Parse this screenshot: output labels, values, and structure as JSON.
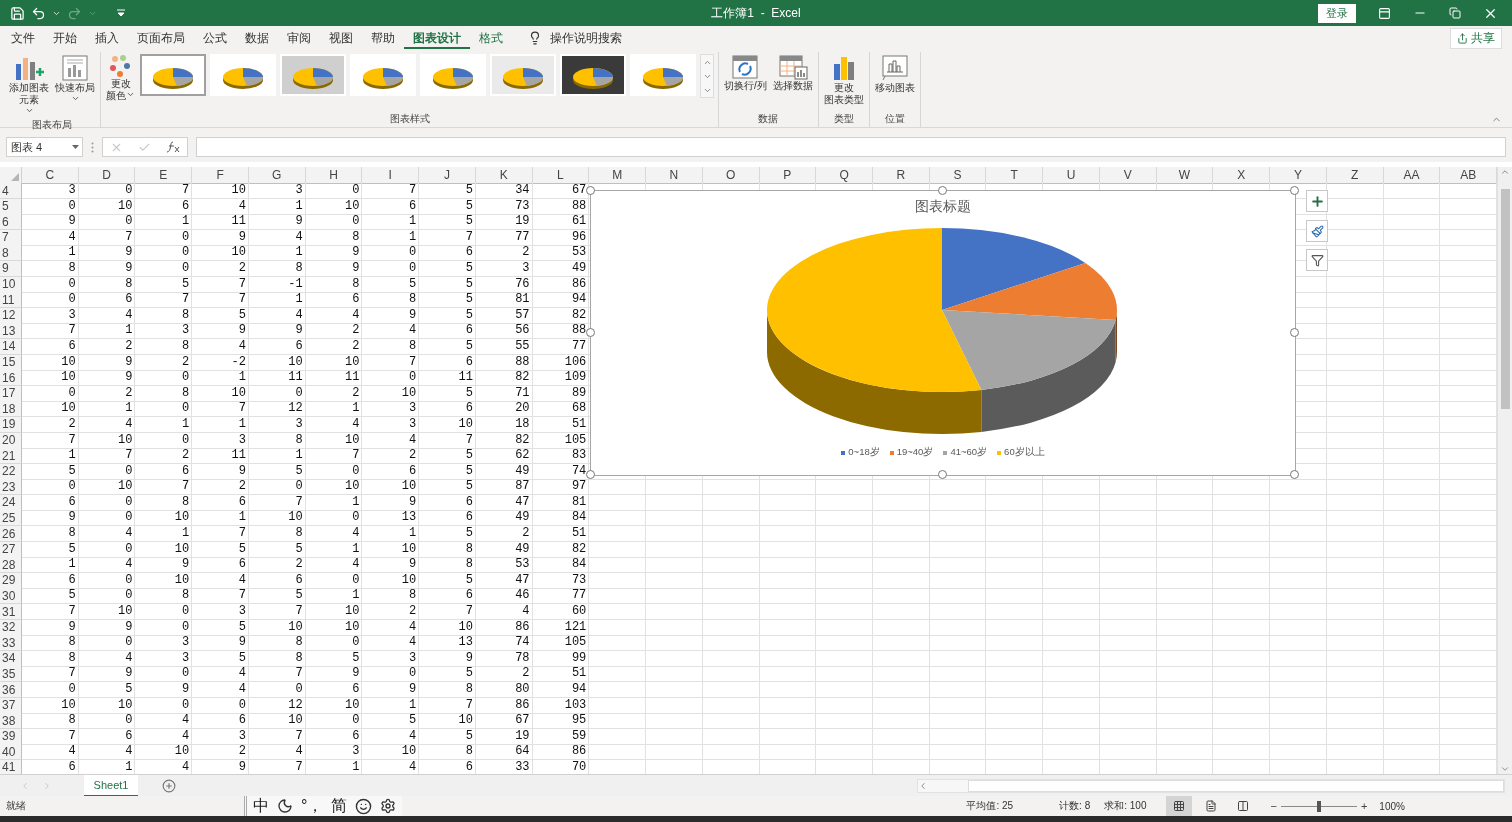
{
  "title_bar": {
    "title": "工作簿1  -  Excel",
    "sign_in": "登录",
    "redo_disabled": true
  },
  "menu_tabs": [
    {
      "label": "文件",
      "selected": false,
      "contextual": false
    },
    {
      "label": "开始",
      "selected": false,
      "contextual": false
    },
    {
      "label": "插入",
      "selected": false,
      "contextual": false
    },
    {
      "label": "页面布局",
      "selected": false,
      "contextual": false
    },
    {
      "label": "公式",
      "selected": false,
      "contextual": false
    },
    {
      "label": "数据",
      "selected": false,
      "contextual": false
    },
    {
      "label": "审阅",
      "selected": false,
      "contextual": false
    },
    {
      "label": "视图",
      "selected": false,
      "contextual": false
    },
    {
      "label": "帮助",
      "selected": false,
      "contextual": false
    },
    {
      "label": "图表设计",
      "selected": true,
      "contextual": true
    },
    {
      "label": "格式",
      "selected": false,
      "contextual": true
    }
  ],
  "tell_me": "操作说明搜索",
  "share": "共享",
  "ribbon": {
    "groups": [
      {
        "kind": "buttons",
        "label": "图表布局",
        "buttons": [
          {
            "kind": "add-element",
            "lines": [
              "添加图表",
              "元素"
            ],
            "dropdown": true
          },
          {
            "kind": "quick-layout",
            "lines": [
              "快速布局"
            ],
            "dropdown": true
          }
        ]
      },
      {
        "kind": "gallery",
        "label": "图表样式",
        "color_button": {
          "lines": [
            "更改",
            "颜色"
          ],
          "dropdown": true
        },
        "styles": [
          {
            "selected": true
          },
          {
            "selected": false
          },
          {
            "selected": false
          },
          {
            "selected": false
          },
          {
            "selected": false
          },
          {
            "selected": false
          },
          {
            "selected": false
          },
          {
            "selected": false
          }
        ]
      },
      {
        "kind": "buttons",
        "label": "数据",
        "buttons": [
          {
            "kind": "switch",
            "lines": [
              "切换行/列"
            ],
            "dropdown": false
          },
          {
            "kind": "select-data",
            "lines": [
              "选择数据"
            ],
            "dropdown": false
          }
        ]
      },
      {
        "kind": "buttons",
        "label": "类型",
        "buttons": [
          {
            "kind": "chart-type",
            "lines": [
              "更改",
              "图表类型"
            ],
            "dropdown": false
          }
        ]
      },
      {
        "kind": "buttons",
        "label": "位置",
        "buttons": [
          {
            "kind": "move",
            "lines": [
              "移动图表"
            ],
            "dropdown": false
          }
        ]
      }
    ]
  },
  "formula_bar": {
    "name_box": "图表 4",
    "edit_disabled": true
  },
  "sheet": {
    "columns": [
      "C",
      "D",
      "E",
      "F",
      "G",
      "H",
      "I",
      "J",
      "K",
      "L",
      "M",
      "N",
      "O",
      "P",
      "Q",
      "R",
      "S",
      "T",
      "U",
      "V",
      "W",
      "X",
      "Y",
      "Z",
      "AA",
      "AB"
    ],
    "rows": [
      {
        "header": "4",
        "cells": [
          "3",
          "0",
          "7",
          "10",
          "3",
          "0",
          "7",
          "5",
          "34",
          "67"
        ]
      },
      {
        "header": "5",
        "cells": [
          "0",
          "10",
          "6",
          "4",
          "1",
          "10",
          "6",
          "5",
          "73",
          "88"
        ]
      },
      {
        "header": "6",
        "cells": [
          "9",
          "0",
          "1",
          "11",
          "9",
          "0",
          "1",
          "5",
          "19",
          "61"
        ]
      },
      {
        "header": "7",
        "cells": [
          "4",
          "7",
          "0",
          "9",
          "4",
          "8",
          "1",
          "7",
          "77",
          "96"
        ]
      },
      {
        "header": "8",
        "cells": [
          "1",
          "9",
          "0",
          "10",
          "1",
          "9",
          "0",
          "6",
          "2",
          "53"
        ]
      },
      {
        "header": "9",
        "cells": [
          "8",
          "9",
          "0",
          "2",
          "8",
          "9",
          "0",
          "5",
          "3",
          "49"
        ]
      },
      {
        "header": "10",
        "cells": [
          "0",
          "8",
          "5",
          "7",
          "-1",
          "8",
          "5",
          "5",
          "76",
          "86"
        ]
      },
      {
        "header": "11",
        "cells": [
          "0",
          "6",
          "7",
          "7",
          "1",
          "6",
          "8",
          "5",
          "81",
          "94"
        ]
      },
      {
        "header": "12",
        "cells": [
          "3",
          "4",
          "8",
          "5",
          "4",
          "4",
          "9",
          "5",
          "57",
          "82"
        ]
      },
      {
        "header": "13",
        "cells": [
          "7",
          "1",
          "3",
          "9",
          "9",
          "2",
          "4",
          "6",
          "56",
          "88"
        ]
      },
      {
        "header": "14",
        "cells": [
          "6",
          "2",
          "8",
          "4",
          "6",
          "2",
          "8",
          "5",
          "55",
          "77"
        ]
      },
      {
        "header": "15",
        "cells": [
          "10",
          "9",
          "2",
          "-2",
          "10",
          "10",
          "7",
          "6",
          "88",
          "106"
        ]
      },
      {
        "header": "16",
        "cells": [
          "10",
          "9",
          "0",
          "1",
          "11",
          "11",
          "0",
          "11",
          "82",
          "109"
        ]
      },
      {
        "header": "17",
        "cells": [
          "0",
          "2",
          "8",
          "10",
          "0",
          "2",
          "10",
          "5",
          "71",
          "89"
        ]
      },
      {
        "header": "18",
        "cells": [
          "10",
          "1",
          "0",
          "7",
          "12",
          "1",
          "3",
          "6",
          "20",
          "68"
        ]
      },
      {
        "header": "19",
        "cells": [
          "2",
          "4",
          "1",
          "1",
          "3",
          "4",
          "3",
          "10",
          "18",
          "51"
        ]
      },
      {
        "header": "20",
        "cells": [
          "7",
          "10",
          "0",
          "3",
          "8",
          "10",
          "4",
          "7",
          "82",
          "105"
        ]
      },
      {
        "header": "21",
        "cells": [
          "1",
          "7",
          "2",
          "11",
          "1",
          "7",
          "2",
          "5",
          "62",
          "83"
        ]
      },
      {
        "header": "22",
        "cells": [
          "5",
          "0",
          "6",
          "9",
          "5",
          "0",
          "6",
          "5",
          "49",
          "74"
        ]
      },
      {
        "header": "23",
        "cells": [
          "0",
          "10",
          "7",
          "2",
          "0",
          "10",
          "10",
          "5",
          "87",
          "97"
        ]
      },
      {
        "header": "24",
        "cells": [
          "6",
          "0",
          "8",
          "6",
          "7",
          "1",
          "9",
          "6",
          "47",
          "81"
        ]
      },
      {
        "header": "25",
        "cells": [
          "9",
          "0",
          "10",
          "1",
          "10",
          "0",
          "13",
          "6",
          "49",
          "84"
        ]
      },
      {
        "header": "26",
        "cells": [
          "8",
          "4",
          "1",
          "7",
          "8",
          "4",
          "1",
          "5",
          "2",
          "51"
        ]
      },
      {
        "header": "27",
        "cells": [
          "5",
          "0",
          "10",
          "5",
          "5",
          "1",
          "10",
          "8",
          "49",
          "82"
        ]
      },
      {
        "header": "28",
        "cells": [
          "1",
          "4",
          "9",
          "6",
          "2",
          "4",
          "9",
          "8",
          "53",
          "84"
        ]
      },
      {
        "header": "29",
        "cells": [
          "6",
          "0",
          "10",
          "4",
          "6",
          "0",
          "10",
          "5",
          "47",
          "73"
        ]
      },
      {
        "header": "30",
        "cells": [
          "5",
          "0",
          "8",
          "7",
          "5",
          "1",
          "8",
          "6",
          "46",
          "77"
        ]
      },
      {
        "header": "31",
        "cells": [
          "7",
          "10",
          "0",
          "3",
          "7",
          "10",
          "2",
          "7",
          "4",
          "60"
        ]
      },
      {
        "header": "32",
        "cells": [
          "9",
          "9",
          "0",
          "5",
          "10",
          "10",
          "4",
          "10",
          "86",
          "121"
        ]
      },
      {
        "header": "33",
        "cells": [
          "8",
          "0",
          "3",
          "9",
          "8",
          "0",
          "4",
          "13",
          "74",
          "105"
        ]
      },
      {
        "header": "34",
        "cells": [
          "8",
          "4",
          "3",
          "5",
          "8",
          "5",
          "3",
          "9",
          "78",
          "99"
        ]
      },
      {
        "header": "35",
        "cells": [
          "7",
          "9",
          "0",
          "4",
          "7",
          "9",
          "0",
          "5",
          "2",
          "51"
        ]
      },
      {
        "header": "36",
        "cells": [
          "0",
          "5",
          "9",
          "4",
          "0",
          "6",
          "9",
          "8",
          "80",
          "94"
        ]
      },
      {
        "header": "37",
        "cells": [
          "10",
          "10",
          "0",
          "0",
          "12",
          "10",
          "1",
          "7",
          "86",
          "103"
        ]
      },
      {
        "header": "38",
        "cells": [
          "8",
          "0",
          "4",
          "6",
          "10",
          "0",
          "5",
          "10",
          "67",
          "95"
        ]
      },
      {
        "header": "39",
        "cells": [
          "7",
          "6",
          "4",
          "3",
          "7",
          "6",
          "4",
          "5",
          "19",
          "59"
        ]
      },
      {
        "header": "40",
        "cells": [
          "4",
          "4",
          "10",
          "2",
          "4",
          "3",
          "10",
          "8",
          "64",
          "86"
        ]
      },
      {
        "header": "41",
        "cells": [
          "6",
          "1",
          "4",
          "9",
          "7",
          "1",
          "4",
          "6",
          "33",
          "70"
        ]
      }
    ]
  },
  "chart": {
    "title": "图表标题",
    "selected": true,
    "legend": [
      {
        "label": "0~18岁",
        "color": "#4472c4"
      },
      {
        "label": "19~40岁",
        "color": "#ed7d31"
      },
      {
        "label": "41~60岁",
        "color": "#a5a5a5"
      },
      {
        "label": "60岁以上",
        "color": "#ffc000"
      }
    ]
  },
  "sheet_tabs": [
    {
      "label": "Sheet1",
      "selected": true
    }
  ],
  "status_bar": {
    "ready": "就绪",
    "ime": [
      {
        "kind": "text",
        "label": "中"
      },
      {
        "kind": "moon"
      },
      {
        "kind": "text",
        "label": "°，"
      },
      {
        "kind": "text",
        "label": "简"
      },
      {
        "kind": "smiley"
      },
      {
        "kind": "gear"
      }
    ],
    "stats": [
      "平均值: 25",
      "计数: 8",
      "求和: 100"
    ],
    "views": [
      {
        "kind": "normal",
        "selected": true
      },
      {
        "kind": "page-layout",
        "selected": false
      },
      {
        "kind": "page-break",
        "selected": false
      }
    ],
    "zoom": {
      "minus": "−",
      "plus": "+",
      "level": 0.5,
      "label": "100%"
    }
  }
}
